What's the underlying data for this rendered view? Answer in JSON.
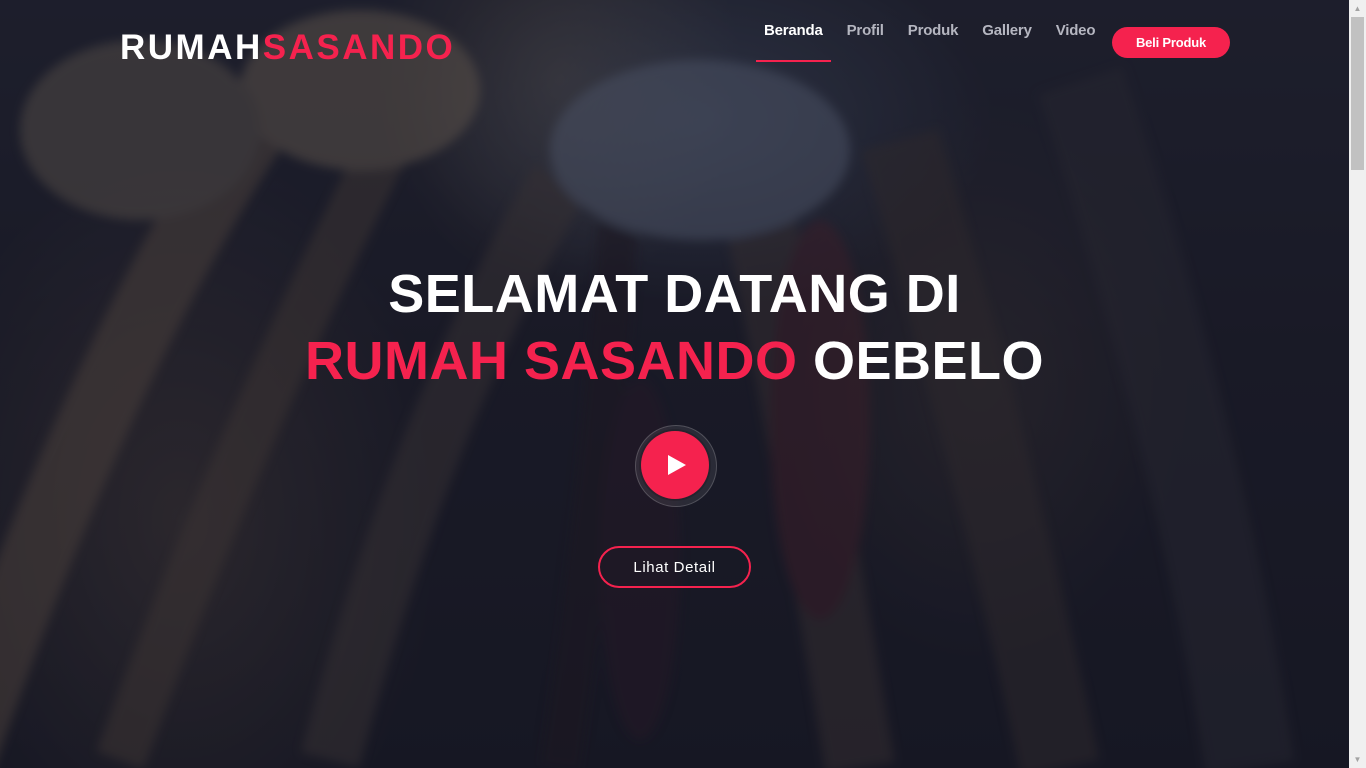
{
  "brand": {
    "part1": "RUMAH",
    "part2": "SASANDO"
  },
  "nav": {
    "items": [
      {
        "label": "Beranda",
        "active": true
      },
      {
        "label": "Profil",
        "active": false
      },
      {
        "label": "Produk",
        "active": false
      },
      {
        "label": "Gallery",
        "active": false
      },
      {
        "label": "Video",
        "active": false
      }
    ],
    "cta_label": "Beli Produk"
  },
  "hero": {
    "line1": "SELAMAT DATANG DI",
    "line2_accent": "RUMAH SASANDO",
    "line2_rest": "OEBELO",
    "play_icon": "play-icon",
    "detail_label": "Lihat Detail"
  },
  "colors": {
    "accent": "#f5224e",
    "overlay": "#1b1d29",
    "nav_inactive": "#b5b6c0"
  }
}
